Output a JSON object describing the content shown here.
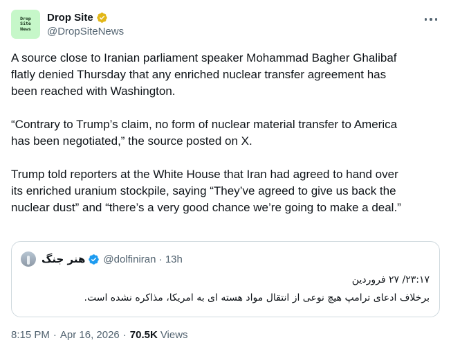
{
  "author": {
    "display_name": "Drop Site",
    "handle": "@DropSiteNews",
    "avatar_text": [
      "Drop",
      "Site",
      "News"
    ],
    "avatar_color": "#c6f7c9",
    "verified_color": "#e2b719"
  },
  "more_icon": "more-horizontal-icon",
  "tweet": {
    "paragraphs": [
      "A source close to Iranian parliament speaker Mohammad Bagher Ghalibaf\nflatly denied Thursday that any enriched nuclear transfer agreement has\nbeen reached with Washington.",
      "“Contrary to Trump’s claim, no form of nuclear material transfer to America\nhas been negotiated,” the source posted on X.",
      "Trump told reporters at the White House that Iran had agreed to hand over\nits enriched uranium stockpile, saying “They’ve agreed to give us back the\nnuclear dust” and “there’s a very good chance we’re going to make a deal.”"
    ]
  },
  "quote": {
    "display_name": "هنر جنگ",
    "handle": "@dolfiniran",
    "separator": "·",
    "time": "13h",
    "verified_color": "#1d9bf0",
    "line1": "۲۳:۱۷/ ۲۷ فروردین",
    "line2": "برخلاف ادعای ترامپ هیچ نوعی از انتقال مواد هسته ای به امریکا، مذاکره نشده است."
  },
  "footer": {
    "time": "8:15 PM",
    "separator": "·",
    "date": "Apr 16, 2026",
    "views_count": "70.5K",
    "views_label": "Views"
  }
}
